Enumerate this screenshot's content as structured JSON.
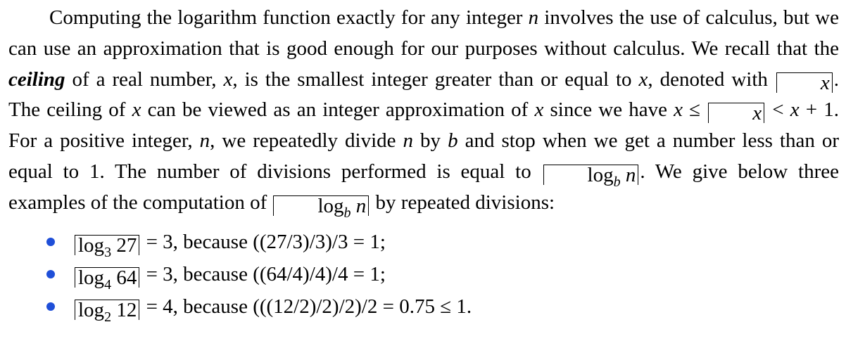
{
  "paragraph": {
    "s1_a": "Computing the logarithm function exactly for any integer ",
    "s1_n": "n",
    "s1_b": " involves the use of calculus, but we can use an approximation that is good enough for our purposes without calculus.  We recall that the ",
    "keyword": "ceiling",
    "s2_a": " of a real number, ",
    "x": "x",
    "s2_b": ", is the smallest integer greater than or equal to ",
    "s2_c": ", denoted with ",
    "s2_d": ". The ceiling of ",
    "s2_e": " can be viewed as an integer approximation of ",
    "s2_f": " since we have ",
    "ineq": " ≤ ",
    "lt": " < ",
    "plus_one": " + 1",
    "s3_a": ".  For a positive integer, ",
    "s3_b": ", we repeatedly divide ",
    "s3_c": " by ",
    "b": "b",
    "s3_d": " and stop when we get a number less than or equal to 1. The number of divisions performed is equal to ",
    "log": "log",
    "s3_e": ". We give below three examples of the computation of ",
    "s3_f": " by repeated divisions:"
  },
  "examples": [
    {
      "base": "3",
      "arg": "27",
      "rest": " = 3, because ((27/3)/3)/3 = 1;"
    },
    {
      "base": "4",
      "arg": "64",
      "rest": " = 3, because ((64/4)/4)/4 = 1;"
    },
    {
      "base": "2",
      "arg": "12",
      "rest": " = 4, because (((12/2)/2)/2)/2 = 0.75 ≤ 1."
    }
  ],
  "colors": {
    "bullet": "#1f4fd8",
    "text": "#000000"
  }
}
